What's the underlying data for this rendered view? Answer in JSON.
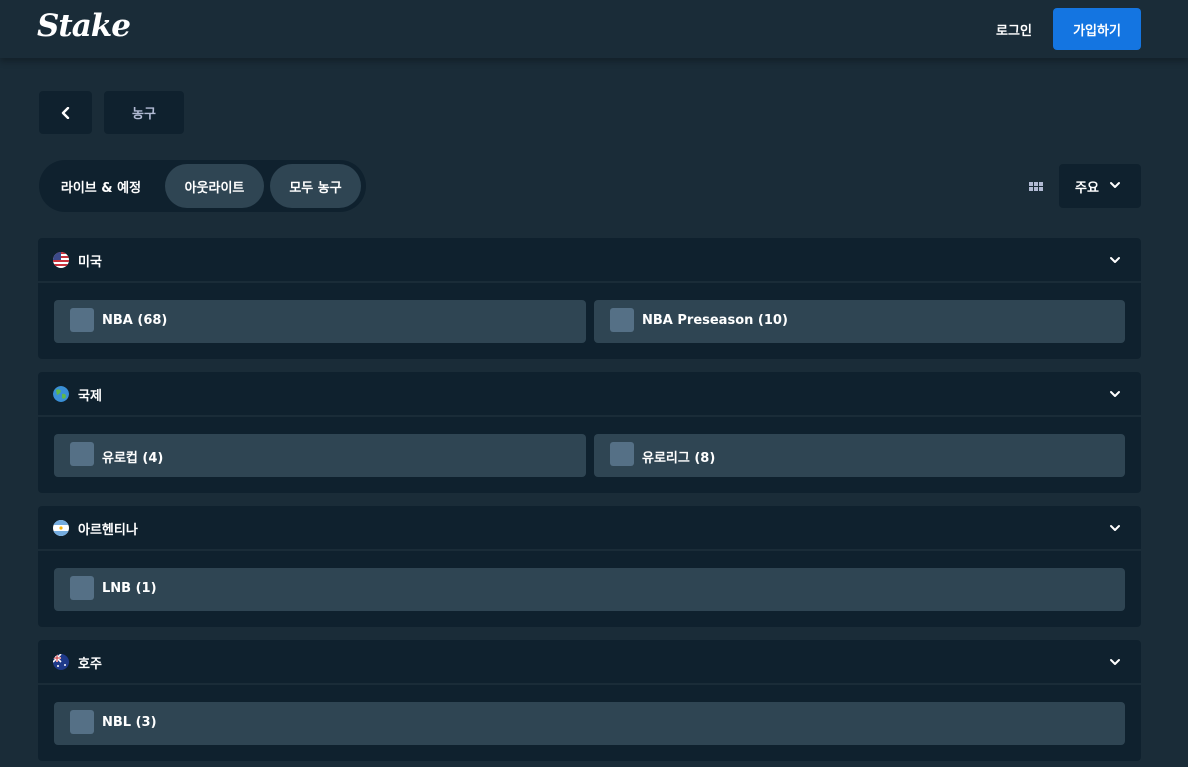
{
  "header": {
    "logo": "Stake",
    "login_label": "로그인",
    "signup_label": "가입하기"
  },
  "breadcrumb": {
    "back_icon": "chevron-left-icon",
    "current": "농구"
  },
  "tabs": [
    {
      "label": "라이브 & 예정"
    },
    {
      "label": "아웃라이트"
    },
    {
      "label": "모두 농구"
    }
  ],
  "view": {
    "grid_icon": "grid-icon",
    "sort_label": "주요"
  },
  "sections": [
    {
      "title": "미국",
      "flag": "us-flag-icon",
      "leagues": [
        {
          "label": "NBA (68)"
        },
        {
          "label": "NBA Preseason (10)"
        }
      ]
    },
    {
      "title": "국제",
      "flag": "globe-icon",
      "leagues": [
        {
          "label": "유로컵 (4)"
        },
        {
          "label": "유로리그 (8)"
        }
      ]
    },
    {
      "title": "아르헨티나",
      "flag": "argentina-flag-icon",
      "leagues": [
        {
          "label": "LNB (1)"
        }
      ]
    },
    {
      "title": "호주",
      "flag": "australia-flag-icon",
      "leagues": [
        {
          "label": "NBL (3)"
        }
      ]
    }
  ],
  "colors": {
    "background": "#1a2c38",
    "panel": "#0f212e",
    "button": "#2f4553",
    "accent": "#1475e1"
  }
}
